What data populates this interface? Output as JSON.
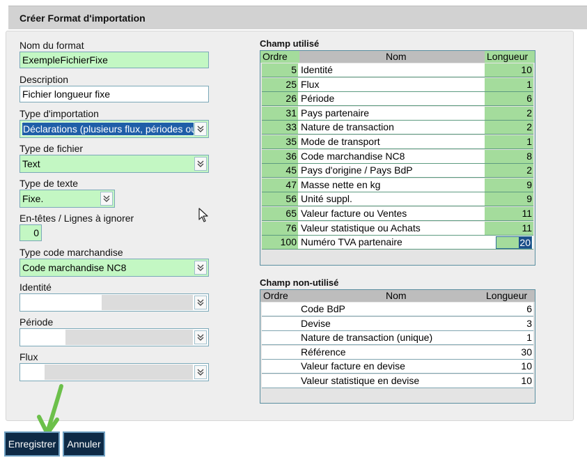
{
  "header": {
    "title": "Créer Format d'importation"
  },
  "form": {
    "nom_label": "Nom du format",
    "nom_value": "ExempleFichierFixe",
    "description_label": "Description",
    "description_value": "Fichier longueur fixe",
    "type_import_label": "Type d'importation",
    "type_import_value": "Déclarations (plusieurs flux, périodes ou",
    "type_fichier_label": "Type de fichier",
    "type_fichier_value": "Text",
    "type_texte_label": "Type de texte",
    "type_texte_value": "Fixe.",
    "entetes_label": "En-têtes / Lignes à ignorer",
    "entetes_value": "0",
    "type_code_label": "Type code marchandise",
    "type_code_value": "Code marchandise NC8",
    "identite_label": "Identité",
    "periode_label": "Période",
    "flux_label": "Flux"
  },
  "used": {
    "title": "Champ utilisé",
    "headers": {
      "ordre": "Ordre",
      "nom": "Nom",
      "longueur": "Longueur"
    },
    "rows": [
      {
        "ordre": "5",
        "nom": "Identité",
        "longueur": "10"
      },
      {
        "ordre": "25",
        "nom": "Flux",
        "longueur": "1"
      },
      {
        "ordre": "26",
        "nom": "Période",
        "longueur": "6"
      },
      {
        "ordre": "31",
        "nom": "Pays partenaire",
        "longueur": "2"
      },
      {
        "ordre": "33",
        "nom": "Nature de transaction",
        "longueur": "2"
      },
      {
        "ordre": "35",
        "nom": "Mode de transport",
        "longueur": "1"
      },
      {
        "ordre": "36",
        "nom": "Code marchandise NC8",
        "longueur": "8"
      },
      {
        "ordre": "45",
        "nom": "Pays d'origine / Pays BdP",
        "longueur": "2"
      },
      {
        "ordre": "47",
        "nom": "Masse nette en kg",
        "longueur": "9"
      },
      {
        "ordre": "56",
        "nom": "Unité suppl.",
        "longueur": "9"
      },
      {
        "ordre": "65",
        "nom": "Valeur facture ou Ventes",
        "longueur": "11"
      },
      {
        "ordre": "76",
        "nom": "Valeur statistique ou Achats",
        "longueur": "11"
      },
      {
        "ordre": "100",
        "nom": "Numéro TVA partenaire",
        "longueur": "20"
      }
    ]
  },
  "unused": {
    "title": "Champ non-utilisé",
    "headers": {
      "ordre": "Ordre",
      "nom": "Nom",
      "longueur": "Longueur"
    },
    "rows": [
      {
        "ordre": "",
        "nom": "Code BdP",
        "longueur": "6"
      },
      {
        "ordre": "",
        "nom": "Devise",
        "longueur": "3"
      },
      {
        "ordre": "",
        "nom": "Nature de transaction (unique)",
        "longueur": "1"
      },
      {
        "ordre": "",
        "nom": "Référence",
        "longueur": "30"
      },
      {
        "ordre": "",
        "nom": "Valeur facture en devise",
        "longueur": "10"
      },
      {
        "ordre": "",
        "nom": "Valeur statistique en devise",
        "longueur": "10"
      }
    ]
  },
  "buttons": {
    "save": "Enregistrer",
    "cancel": "Annuler"
  },
  "colors": {
    "field_green": "#c3f7c3",
    "table_green": "#a4dc9c",
    "button_dark": "#0e2a46",
    "annotation_arrow": "#6cc04a"
  }
}
